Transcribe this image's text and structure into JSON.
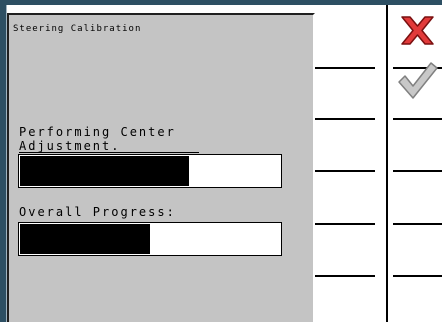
{
  "dialog": {
    "title": "Steering Calibration",
    "center_label": "Performing Center Adjustment.",
    "center_progress": 0.65,
    "overall_label": "Overall Progress:",
    "overall_progress": 0.5
  },
  "softkeys": [
    {
      "icon": "cancel-x-icon",
      "color": "#e23a3a"
    },
    {
      "icon": "accept-check-icon",
      "color": "#c8c8c8"
    }
  ],
  "colors": {
    "frame": "#2d4f63",
    "dialog_bg": "#c4c4c4",
    "cancel_red": "#e23a3a"
  }
}
